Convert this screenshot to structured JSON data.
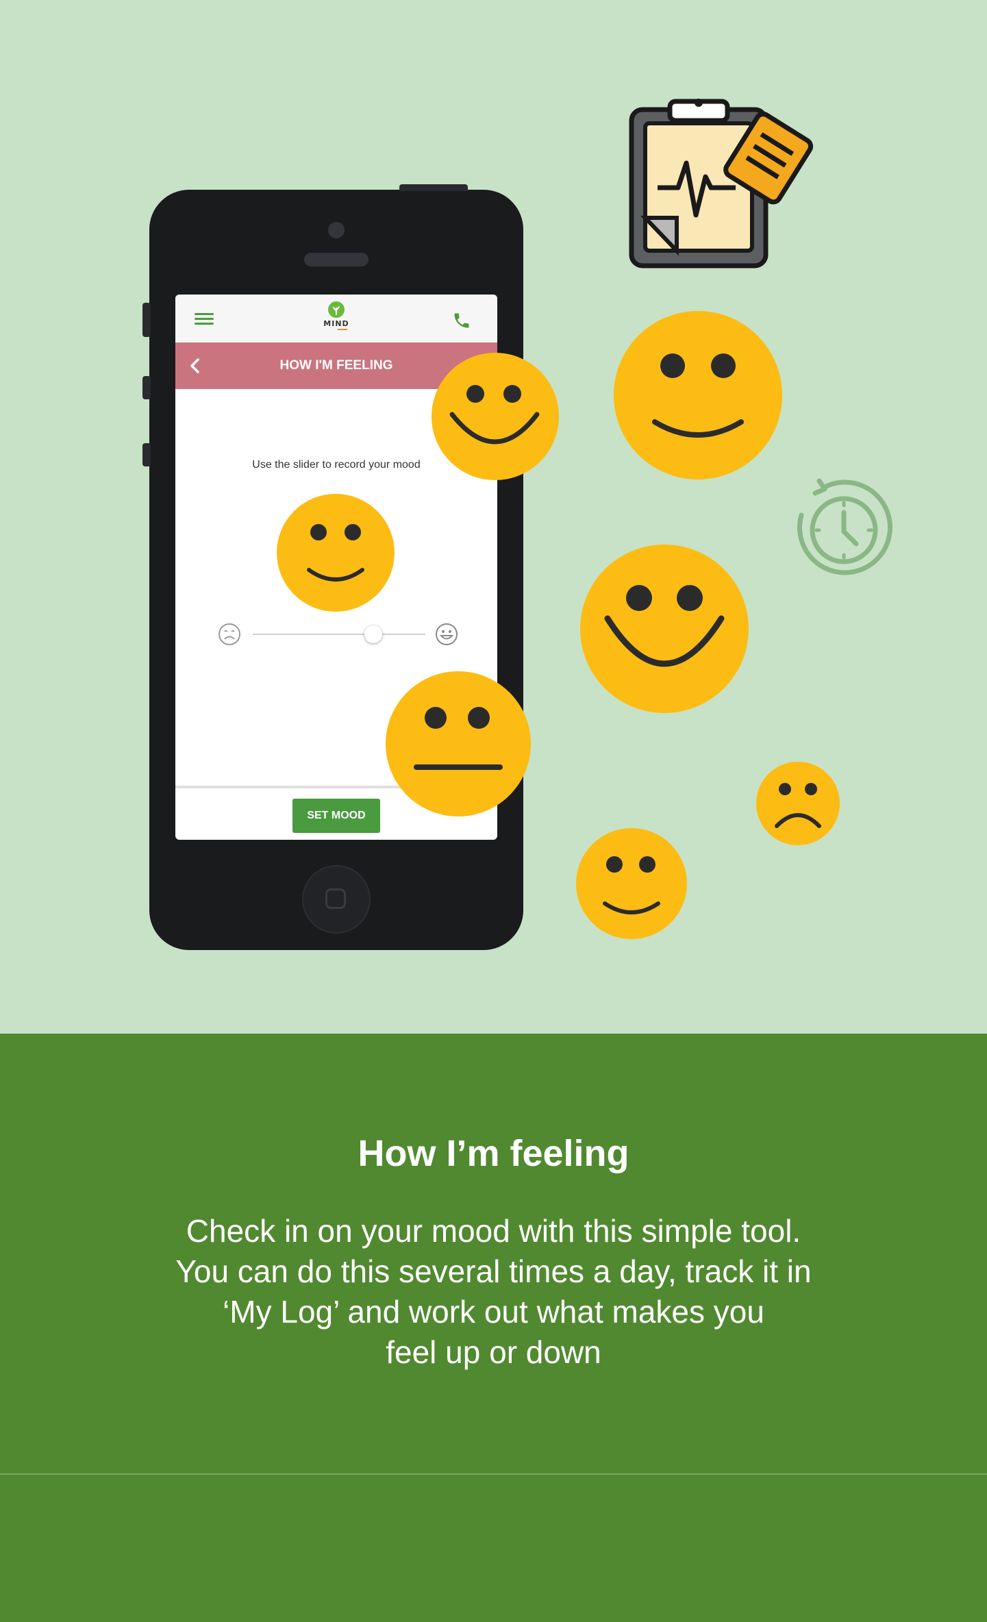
{
  "app": {
    "logo_text": "MIND",
    "screen_title": "HOW I'M FEELING",
    "instruction": "Use the slider to record your mood",
    "mood_level": 0.7,
    "set_mood_label": "SET MOOD"
  },
  "icons": {
    "menu": "menu-icon",
    "phone": "phone-icon",
    "back": "chevron-left-icon",
    "sad_end": "sad-face-icon",
    "happy_end": "happy-face-icon",
    "clipboard": "clipboard-heartbeat-icon",
    "clock": "clock-refresh-icon"
  },
  "colors": {
    "hero_bg": "#c8e2c7",
    "banner_bg": "#518930",
    "title_bar": "#ca7480",
    "set_mood_button": "#4a9a40",
    "emoji_yellow": "#fcbc13"
  },
  "banner": {
    "title": "How I’m feeling",
    "lines": [
      "Check in on your mood with this simple tool.",
      "You can do this several times a day, track it in",
      "‘My Log’ and work out what makes you",
      "feel up or down"
    ]
  }
}
